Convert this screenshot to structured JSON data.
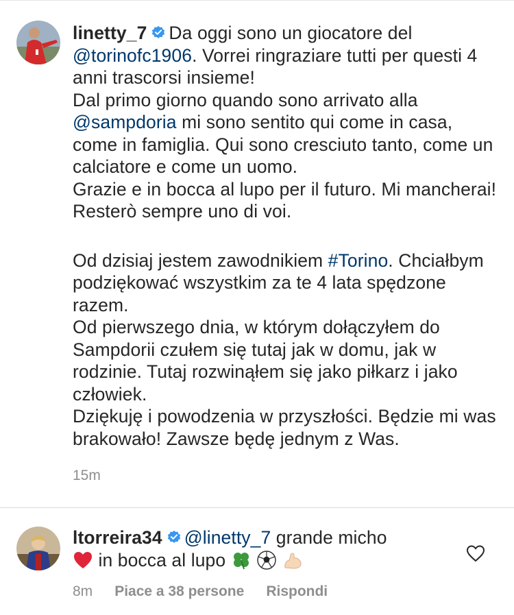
{
  "caption": {
    "username": "linetty_7",
    "lines_it": [
      [
        "Da oggi sono un giocatore del ",
        "@torinofc1906",
        ". Vorrei ringraziare tutti per questi 4 anni trascorsi insieme!"
      ]
    ],
    "intro_text": "Da oggi sono un giocatore del",
    "mention_torino": "@torinofc1906",
    "intro_text_2": ". Vorrei ringraziare tutti per questi 4 anni trascorsi insieme!",
    "para2_a": "Dal primo giorno quando sono arrivato alla",
    "mention_sampdoria": "@sampdoria",
    "para2_b": " mi sono sentito qui come in casa, come in famiglia. Qui sono cresciuto tanto, come un calciatore e come un uomo.",
    "para3": "Grazie e in bocca al lupo per il futuro. Mi mancherai! Resterò sempre uno di voi.",
    "para4_a": "Od dzisiaj jestem zawodnikiem ",
    "hashtag_torino": "#Torino",
    "para4_b": ". Chciałbym podziękować wszystkim za te 4 lata spędzone razem.",
    "para5": "Od pierwszego dnia, w którym dołączyłem do Sampdorii czułem się tutaj jak w domu, jak w rodzinie. Tutaj rozwinąłem się jako piłkarz i jako człowiek.",
    "para6": "Dziękuję i powodzenia w przyszłości. Będzie mi was brakowało! Zawsze będę jednym z Was.",
    "time": "15m"
  },
  "comment": {
    "username": "ltorreira34",
    "mention": "@linetty_7",
    "text_a": " grande micho",
    "text_b": " in bocca al lupo",
    "time": "8m",
    "likes": "Piace a 38 persone",
    "reply": "Rispondi"
  },
  "icons": {
    "verified": "verified-badge-icon",
    "like": "heart-outline-icon",
    "emojis": [
      "red-heart-emoji",
      "four-leaf-clover-emoji",
      "soccer-ball-emoji",
      "flexed-biceps-emoji"
    ]
  },
  "colors": {
    "text": "#262626",
    "link": "#00376b",
    "muted": "#8e8e8e",
    "verified": "#3897f0"
  }
}
